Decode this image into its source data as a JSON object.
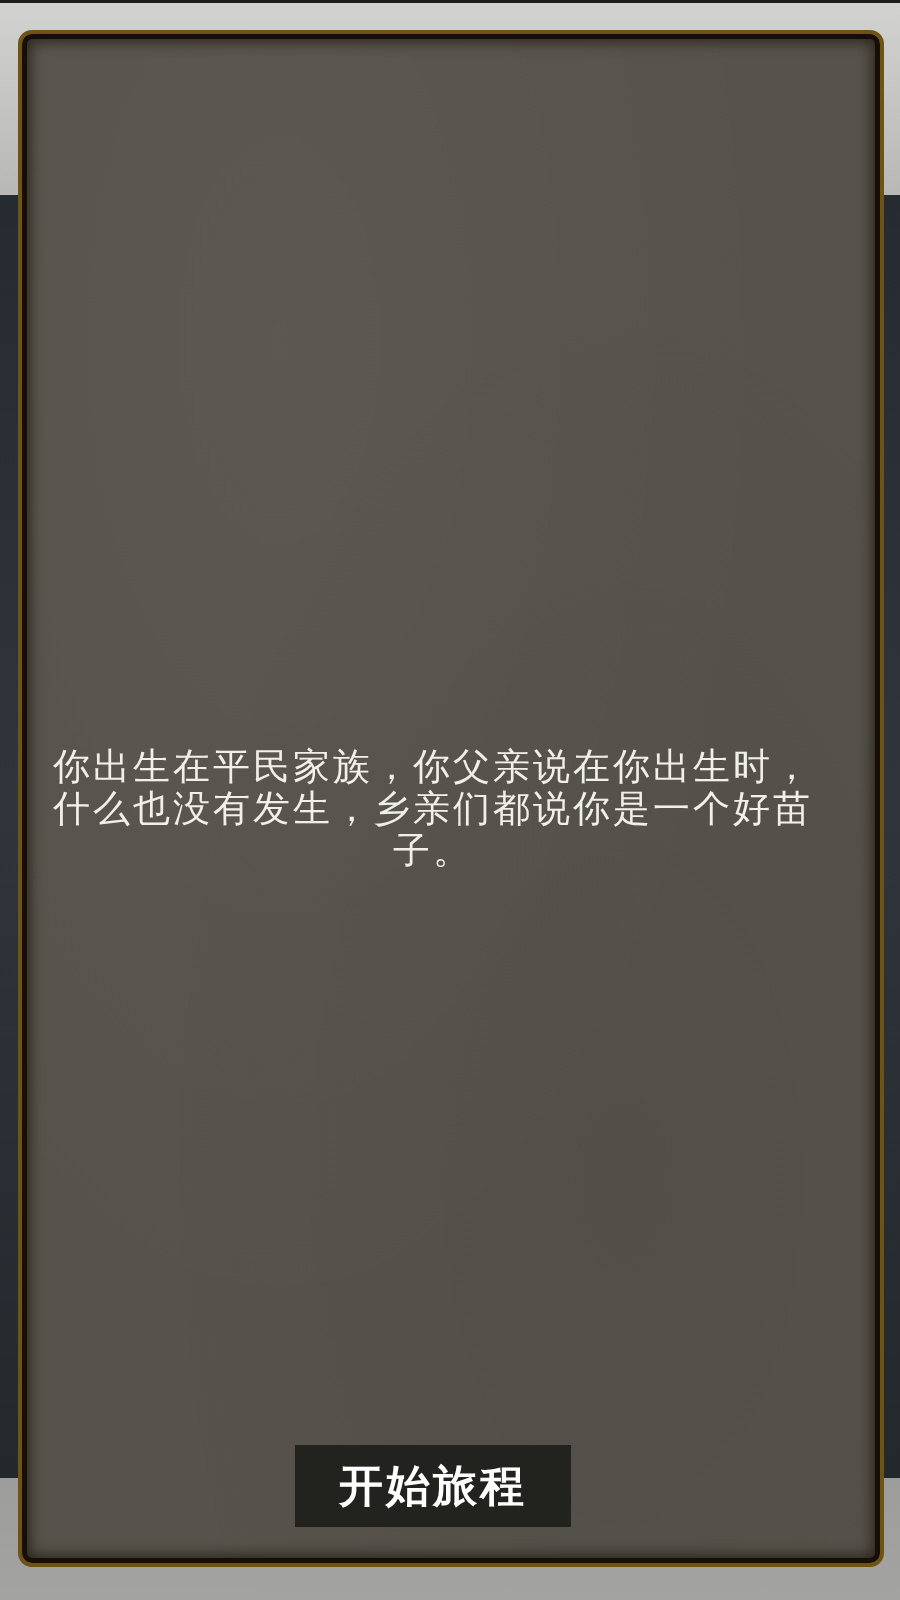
{
  "dialog": {
    "story_text": "你出生在平民家族，你父亲说在你出生时，什么也没有发生，乡亲们都说你是一个好苗子。",
    "start_button": "开始旅程"
  }
}
